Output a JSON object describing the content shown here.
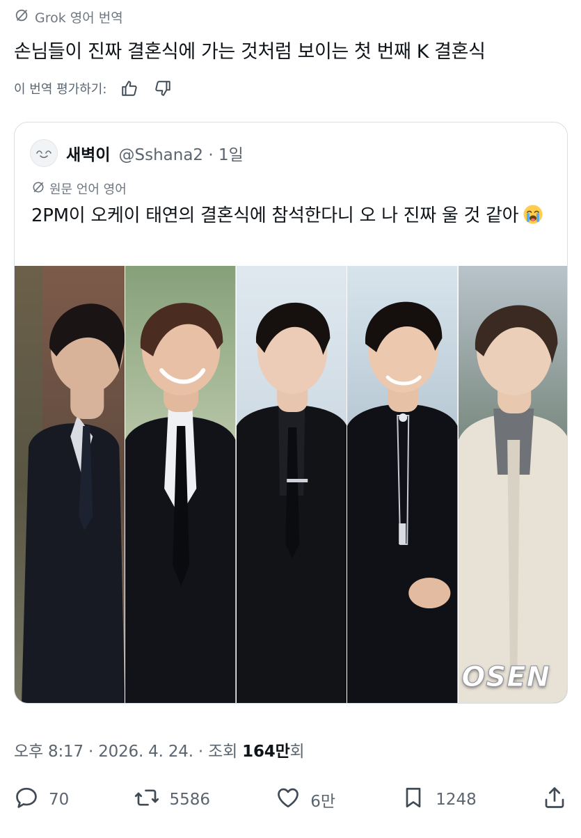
{
  "translation": {
    "banner": "Grok 영어 번역",
    "text": "손님들이 진짜 결혼식에 가는 것처럼 보이는 첫 번째 K 결혼식",
    "rate_label": "이 번역 평가하기:"
  },
  "quote": {
    "name": "새벽이",
    "handle": "@Sshana2 · 1일",
    "original_lang": "원문 언어 영어",
    "text": "2PM이 오케이 태연의 결혼식에 참석한다니 오 나 진짜 울 것 같아",
    "emoji_icon": "loudly-crying-face",
    "watermark": "OSEN"
  },
  "meta": {
    "time_date": "오후 8:17 · 2026. 4. 24. · 조회 ",
    "views": "164만",
    "views_suffix": "회"
  },
  "actions": {
    "replies": "70",
    "reposts": "5586",
    "likes": "6만",
    "bookmarks": "1248"
  },
  "colors": {
    "text": "#0f1419",
    "muted": "#5b6570",
    "border": "#d9dee3"
  }
}
